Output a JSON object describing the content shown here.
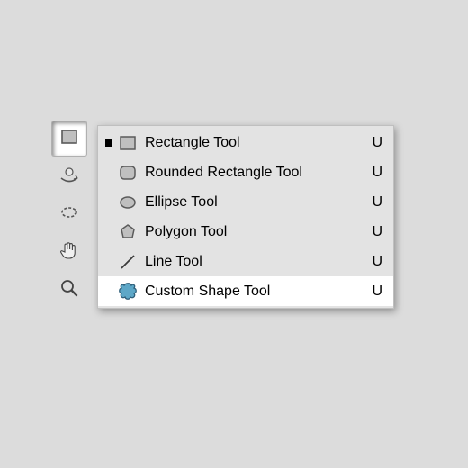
{
  "toolbar": {
    "slots": [
      {
        "name": "shapes-tool",
        "icon": "rect",
        "pressed": true
      },
      {
        "name": "rotate3d-tool",
        "icon": "rotate3d",
        "pressed": false
      },
      {
        "name": "orbit-tool",
        "icon": "orbit",
        "pressed": false
      },
      {
        "name": "hand-tool",
        "icon": "hand",
        "pressed": false
      },
      {
        "name": "zoom-tool",
        "icon": "zoom",
        "pressed": false
      }
    ]
  },
  "flyout": {
    "items": [
      {
        "name": "rectangle-tool",
        "icon": "rect",
        "label": "Rectangle Tool",
        "shortcut": "U",
        "current": true,
        "highlight": false
      },
      {
        "name": "rounded-rectangle-tool",
        "icon": "rrect",
        "label": "Rounded Rectangle Tool",
        "shortcut": "U",
        "current": false,
        "highlight": false
      },
      {
        "name": "ellipse-tool",
        "icon": "ellipse",
        "label": "Ellipse Tool",
        "shortcut": "U",
        "current": false,
        "highlight": false
      },
      {
        "name": "polygon-tool",
        "icon": "polygon",
        "label": "Polygon Tool",
        "shortcut": "U",
        "current": false,
        "highlight": false
      },
      {
        "name": "line-tool",
        "icon": "line",
        "label": "Line Tool",
        "shortcut": "U",
        "current": false,
        "highlight": false
      },
      {
        "name": "custom-shape-tool",
        "icon": "blob",
        "label": "Custom Shape Tool",
        "shortcut": "U",
        "current": false,
        "highlight": true
      }
    ]
  },
  "colors": {
    "bg": "#dcdcdc",
    "flyout_bg": "#e3e3e3",
    "highlight": "#ffffff",
    "shape_fill": "#bfbfbf",
    "shape_stroke": "#5a5a5a",
    "blob_fill": "#5da7c7",
    "blob_stroke": "#2f5f7a"
  }
}
